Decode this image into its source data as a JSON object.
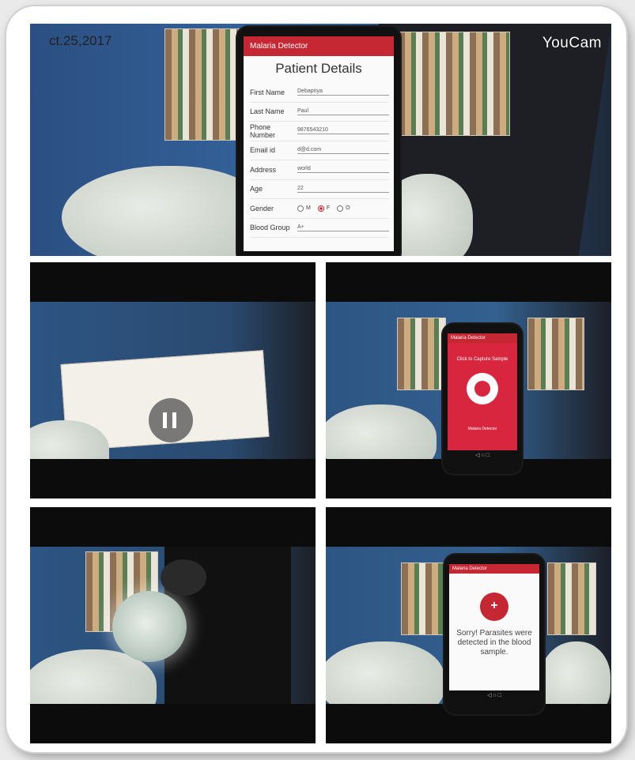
{
  "overlay": {
    "date_stamp": "ct.25,2017",
    "watermark": "YouCam"
  },
  "patient_form": {
    "app_title": "Malaria Detector",
    "heading": "Patient Details",
    "fields": [
      {
        "label": "First Name",
        "value": "Debapriya"
      },
      {
        "label": "Last Name",
        "value": "Paul"
      },
      {
        "label": "Phone Number",
        "value": "9876543210"
      },
      {
        "label": "Email id",
        "value": "d@d.com"
      },
      {
        "label": "Address",
        "value": "world"
      },
      {
        "label": "Age",
        "value": "22"
      }
    ],
    "gender": {
      "label": "Gender",
      "options": [
        "M",
        "F",
        "O"
      ],
      "selected": "F"
    },
    "blood_group": {
      "label": "Blood Group",
      "value": "A+"
    }
  },
  "capture_screen": {
    "app_title": "Malaria Detector",
    "instruction": "Click to Capture Sample",
    "brand": "Malaria Detector"
  },
  "result_screen": {
    "app_title": "Malaria Detector",
    "message": "Sorry! Parasites were detected in the blood sample."
  },
  "colors": {
    "app_red": "#c62833",
    "capture_red": "#d7263d"
  }
}
